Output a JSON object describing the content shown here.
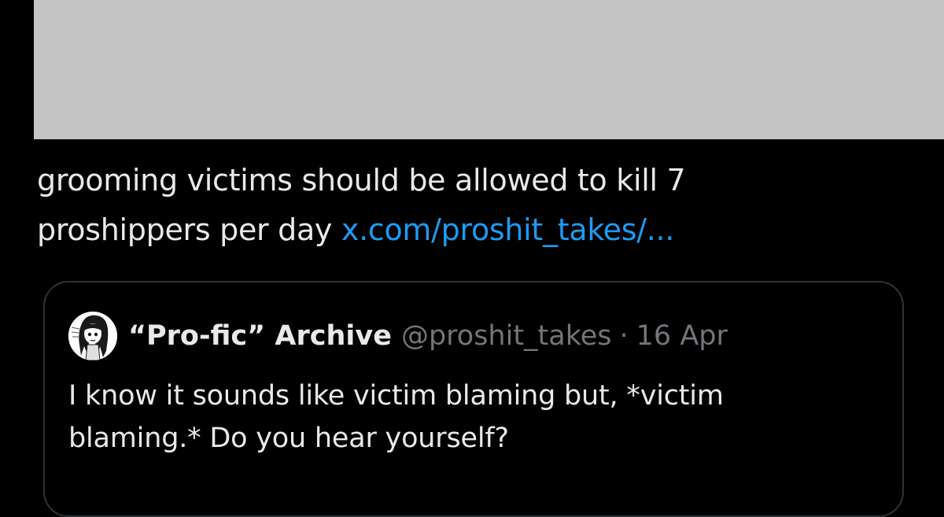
{
  "tweet": {
    "text_line1": "grooming victims should be allowed to kill 7",
    "text_line2": "proshippers per day",
    "link": "x.com/proshit_takes/..."
  },
  "quote": {
    "display_name": "“Pro-fic” Archive",
    "handle": "@proshit_takes",
    "separator": "·",
    "date": "16 Apr",
    "avatar_icon": "anime-girl-avatar-icon",
    "text_line1": "I know it sounds like victim blaming but, *victim",
    "text_line2": "blaming.* Do you hear yourself?"
  },
  "colors": {
    "background": "#000000",
    "redaction": "#c4c4c4",
    "text": "#e7e9ea",
    "link": "#1d9bf0",
    "muted": "#71767b",
    "border": "#2f3336"
  }
}
